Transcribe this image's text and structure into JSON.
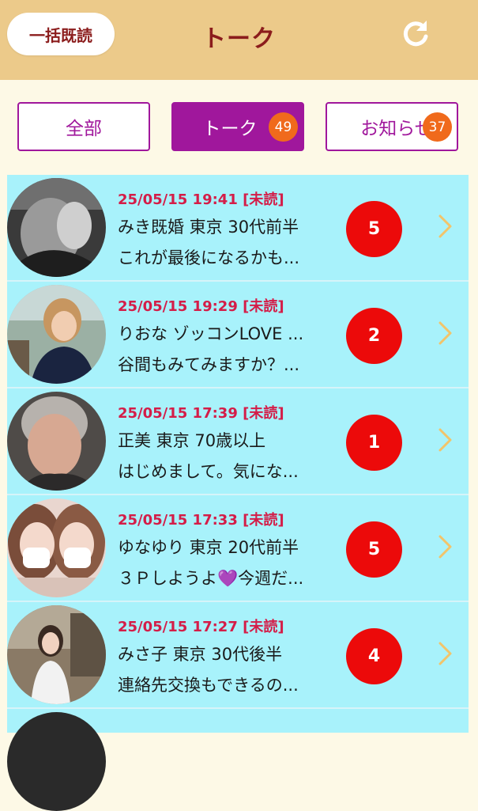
{
  "header": {
    "read_all_label": "一括既読",
    "title": "トーク",
    "refresh_icon": "refresh-icon"
  },
  "tabs": [
    {
      "label": "全部",
      "badge": null,
      "active": false
    },
    {
      "label": "トーク",
      "badge": "49",
      "active": true
    },
    {
      "label": "お知らせ",
      "badge": "37",
      "active": false
    }
  ],
  "messages": [
    {
      "time": "25/05/15 19:41",
      "status": "[未読]",
      "name": "みき既婚 東京 30代前半",
      "preview": "これが最後になるかも...",
      "unread": "5"
    },
    {
      "time": "25/05/15 19:29",
      "status": "[未読]",
      "name": "りおな ゾッコンLOVE ...",
      "preview": "谷間もみてみますか？...",
      "unread": "2"
    },
    {
      "time": "25/05/15 17:39",
      "status": "[未読]",
      "name": "正美 東京 70歳以上",
      "preview": "はじめまして。気にな...",
      "unread": "1"
    },
    {
      "time": "25/05/15 17:33",
      "status": "[未読]",
      "name": "ゆなゆり 東京 20代前半",
      "preview": "３Ｐしようよ💜今週だ...",
      "unread": "5"
    },
    {
      "time": "25/05/15 17:27",
      "status": "[未読]",
      "name": "みさ子 東京 30代後半",
      "preview": "連絡先交換もできるの...",
      "unread": "4"
    }
  ],
  "colors": {
    "header_bg": "#ecca8a",
    "title": "#8b1c1c",
    "tab_accent": "#a0179c",
    "tab_badge": "#f06a1c",
    "row_bg": "#a8f2fb",
    "timestamp": "#d41d48",
    "unread_badge": "#ec0a0a",
    "chevron": "#f2c46a"
  }
}
